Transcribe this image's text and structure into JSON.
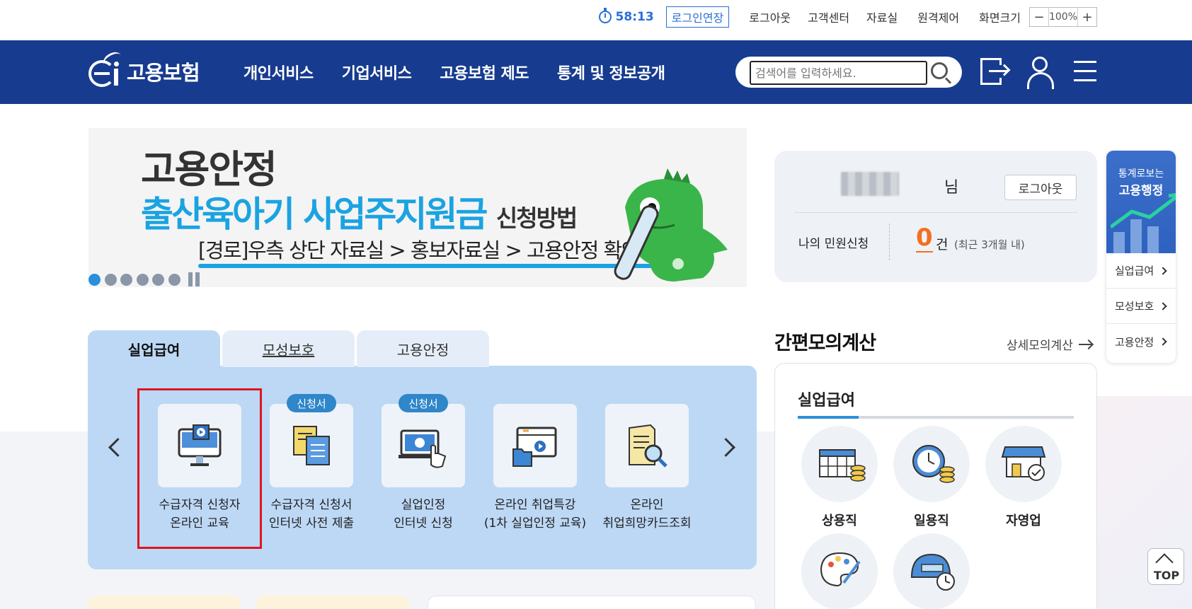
{
  "util": {
    "timer": "58:13",
    "extend_label": "로그인연장",
    "links": [
      "로그아웃",
      "고객센터",
      "자료실",
      "원격제어"
    ],
    "zoom_label": "화면크기",
    "zoom_minus": "−",
    "zoom_value": "100%",
    "zoom_plus": "+"
  },
  "header": {
    "logo_text": "고용보험",
    "gnb": [
      "개인서비스",
      "기업서비스",
      "고용보험 제도",
      "통계 및 정보공개"
    ],
    "search_placeholder": "검색어를 입력하세요."
  },
  "banner": {
    "line1": "고용안정",
    "line2_main": "출산육아기 사업주지원금",
    "line2_sub": "신청방법",
    "line3": "[경로]우측 상단 자료실 > 홍보자료실 > 고용안정 확인",
    "slide_count": 6,
    "active_slide": 1
  },
  "tabs": [
    {
      "label": "실업급여",
      "active": true
    },
    {
      "label": "모성보호",
      "active": false
    },
    {
      "label": "고용안정",
      "active": false
    }
  ],
  "services": [
    {
      "line1": "수급자격 신청자",
      "line2": "온라인 교육",
      "badge": "",
      "icon": "monitor-video-icon"
    },
    {
      "line1": "수급자격 신청서",
      "line2": "인터넷 사전 제출",
      "badge": "신청서",
      "icon": "documents-icon"
    },
    {
      "line1": "실업인정",
      "line2": "인터넷 신청",
      "badge": "신청서",
      "icon": "laptop-touch-icon"
    },
    {
      "line1": "온라인 취업특강",
      "line2": "(1차 실업인정 교육)",
      "badge": "",
      "icon": "video-folder-icon"
    },
    {
      "line1": "온라인",
      "line2": "취업희망카드조회",
      "badge": "",
      "icon": "document-search-icon"
    }
  ],
  "login": {
    "nim": "님",
    "logout_label": "로그아웃",
    "my_label": "나의 민원신청",
    "count": "0",
    "unit": "건",
    "note": "(최근 3개월 내)"
  },
  "calc": {
    "title": "간편모의계산",
    "detail_link": "상세모의계산",
    "sub_title": "실업급여",
    "progress": 0.22,
    "items": [
      {
        "label": "상용직",
        "icon": "calendar-coins-icon"
      },
      {
        "label": "일용직",
        "icon": "clock-coins-icon"
      },
      {
        "label": "자영업",
        "icon": "store-check-icon"
      },
      {
        "label": "",
        "icon": "palette-icon"
      },
      {
        "label": "",
        "icon": "helmet-clock-icon"
      }
    ]
  },
  "quick": {
    "title1": "통계로보는",
    "title2": "고용행정",
    "items": [
      "실업급여",
      "모성보호",
      "고용안정"
    ]
  },
  "top_label": "TOP",
  "colors": {
    "header_bg": "#173b8f",
    "accent_blue": "#2a6fd6",
    "banner_cyan": "#1ba3e1",
    "panel_bg": "#bcd8f5",
    "highlight_red": "#e0141e",
    "count_orange": "#f36f21"
  }
}
